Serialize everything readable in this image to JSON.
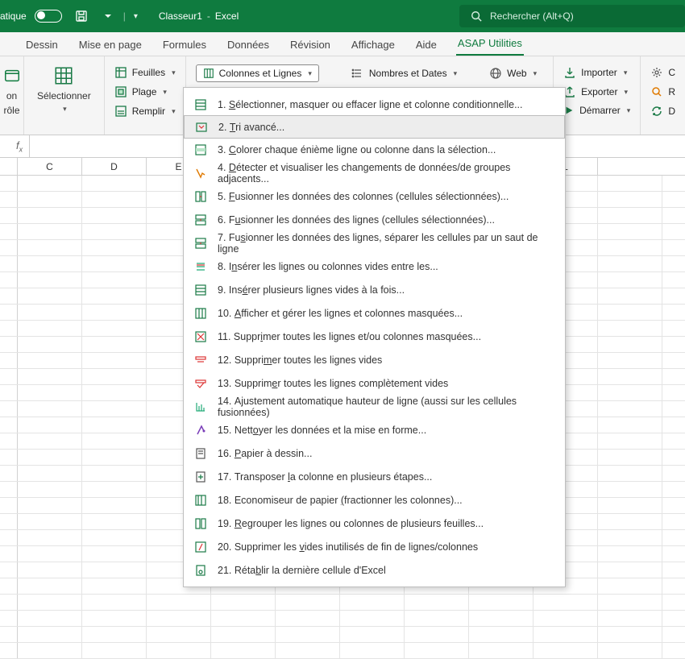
{
  "titlebar": {
    "auto_save_label": "atique",
    "doc_name": "Classeur1",
    "app_name": "Excel",
    "search_placeholder": "Rechercher (Alt+Q)"
  },
  "tabs": {
    "items": [
      "Dessin",
      "Mise en page",
      "Formules",
      "Données",
      "Révision",
      "Affichage",
      "Aide",
      "ASAP Utilities"
    ],
    "active_index": 7
  },
  "ribbon": {
    "control_group": {
      "line1": "on",
      "line2": "rôle"
    },
    "select_btn": "Sélectionner",
    "sheets": {
      "feuilles": "Feuilles",
      "plage": "Plage",
      "remplir": "Remplir"
    },
    "cols_rows_btn": "Colonnes et Lignes",
    "numbers_dates_btn": "Nombres et Dates",
    "web_btn": "Web",
    "importer": "Importer",
    "exporter": "Exporter",
    "demarrer": "Démarrer",
    "c_btn": "C",
    "r_btn": "R",
    "d_btn": "D"
  },
  "columns": [
    "C",
    "D",
    "E",
    "",
    "",
    "",
    "",
    "",
    "L"
  ],
  "menu": {
    "items": [
      {
        "n": "1",
        "before": "",
        "u": "S",
        "after": "électionner, masquer ou effacer ligne et colonne conditionnelle..."
      },
      {
        "n": "2",
        "before": "",
        "u": "T",
        "after": "ri avancé..."
      },
      {
        "n": "3",
        "before": "",
        "u": "C",
        "after": "olorer chaque énième ligne ou colonne dans la sélection..."
      },
      {
        "n": "4",
        "before": "",
        "u": "D",
        "after": "étecter et visualiser les changements de données/de groupes adjacents..."
      },
      {
        "n": "5",
        "before": "",
        "u": "F",
        "after": "usionner les données des colonnes (cellules sélectionnées)..."
      },
      {
        "n": "6",
        "before": "F",
        "u": "u",
        "after": "sionner les données des lignes  (cellules sélectionnées)..."
      },
      {
        "n": "7",
        "before": "Fu",
        "u": "s",
        "after": "ionner les données des lignes, séparer les cellules par un saut de ligne"
      },
      {
        "n": "8",
        "before": "I",
        "u": "n",
        "after": "sérer les lignes ou colonnes vides entre les..."
      },
      {
        "n": "9",
        "before": "Ins",
        "u": "é",
        "after": "rer plusieurs lignes vides à la fois..."
      },
      {
        "n": "10",
        "before": "",
        "u": "A",
        "after": "fficher et gérer les lignes et colonnes masquées..."
      },
      {
        "n": "11",
        "before": "Suppr",
        "u": "i",
        "after": "mer toutes les lignes et/ou colonnes masquées..."
      },
      {
        "n": "12",
        "before": "Suppri",
        "u": "m",
        "after": "er toutes les lignes vides"
      },
      {
        "n": "13",
        "before": "Supprim",
        "u": "e",
        "after": "r toutes les lignes complètement vides"
      },
      {
        "n": "14",
        "before": "A",
        "u": "j",
        "after": "ustement automatique hauteur de ligne (aussi sur les cellules fusionnées)"
      },
      {
        "n": "15",
        "before": "Nett",
        "u": "o",
        "after": "yer les données et la mise en forme..."
      },
      {
        "n": "16",
        "before": "",
        "u": "P",
        "after": "apier à dessin..."
      },
      {
        "n": "17",
        "before": "Transposer ",
        "u": "l",
        "after": "a colonne en plusieurs étapes..."
      },
      {
        "n": "18",
        "before": "Economiseur de papier ",
        "u": "(",
        "after": "fractionner les colonnes)..."
      },
      {
        "n": "19",
        "before": "",
        "u": "R",
        "after": "egrouper les lignes ou colonnes de plusieurs feuilles..."
      },
      {
        "n": "20",
        "before": "Supprimer les ",
        "u": "v",
        "after": "ides inutilisés de fin de lignes/colonnes"
      },
      {
        "n": "21",
        "before": "Réta",
        "u": "b",
        "after": "lir la dernière cellule d'Excel"
      }
    ],
    "highlight_index": 1
  }
}
